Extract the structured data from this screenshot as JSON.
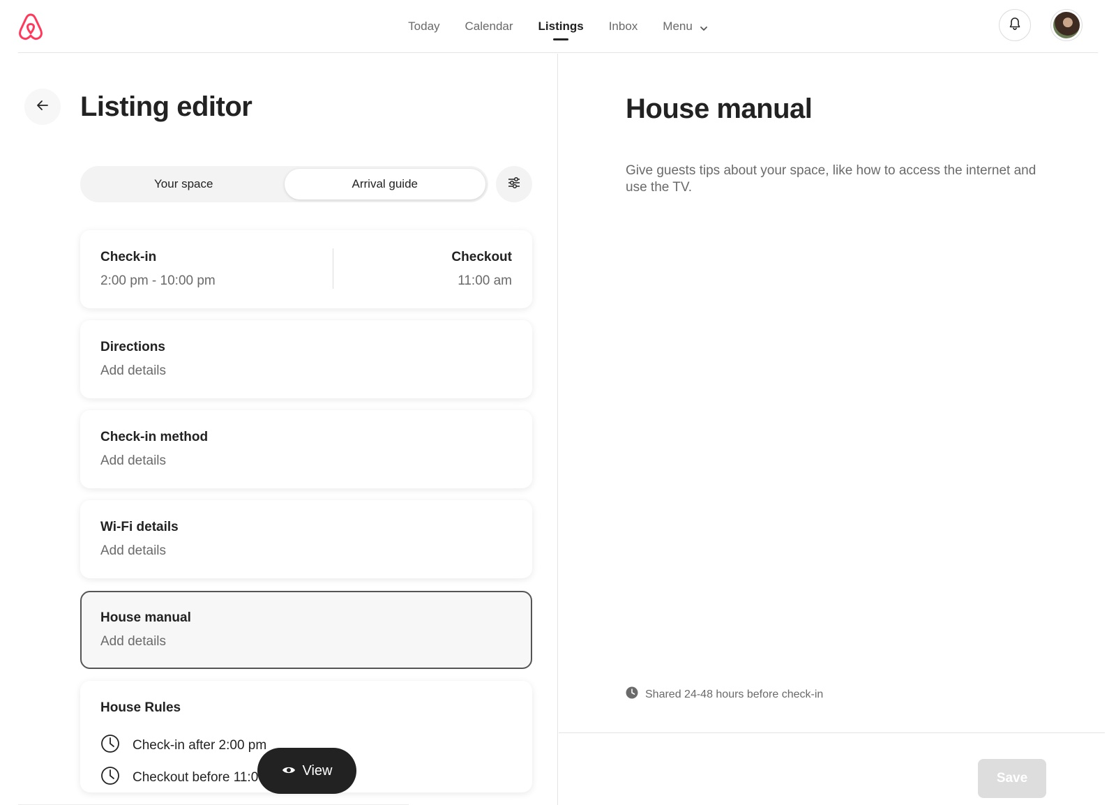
{
  "nav": {
    "items": [
      {
        "label": "Today",
        "active": false
      },
      {
        "label": "Calendar",
        "active": false
      },
      {
        "label": "Listings",
        "active": true
      },
      {
        "label": "Inbox",
        "active": false
      },
      {
        "label": "Menu",
        "active": false
      }
    ]
  },
  "editor": {
    "title": "Listing editor",
    "tabs": [
      {
        "label": "Your space",
        "active": false
      },
      {
        "label": "Arrival guide",
        "active": true
      }
    ],
    "checkin": {
      "title": "Check-in",
      "value": "2:00 pm - 10:00 pm",
      "checkout_title": "Checkout",
      "checkout_value": "11:00 am"
    },
    "cards": [
      {
        "title": "Directions",
        "sub": "Add details"
      },
      {
        "title": "Check-in method",
        "sub": "Add details"
      },
      {
        "title": "Wi-Fi details",
        "sub": "Add details"
      },
      {
        "title": "House manual",
        "sub": "Add details",
        "selected": true
      }
    ],
    "rules": {
      "title": "House Rules",
      "items": [
        "Check-in after 2:00 pm",
        "Checkout before 11:00 am"
      ]
    },
    "view_button": "View"
  },
  "detail": {
    "title": "House manual",
    "description": "Give guests tips about your space, like how to access the internet and use the TV.",
    "shared_note": "Shared 24-48 hours before check-in",
    "save_label": "Save"
  },
  "colors": {
    "brand": "#FF385C",
    "text": "#222222",
    "muted": "#6a6a6a",
    "save_disabled": "#dddddd"
  },
  "icons": [
    "airbnb-logo",
    "chevron-down-icon",
    "bell-icon",
    "avatar",
    "arrow-left-icon",
    "sliders-icon",
    "clock-icon",
    "eye-icon"
  ]
}
